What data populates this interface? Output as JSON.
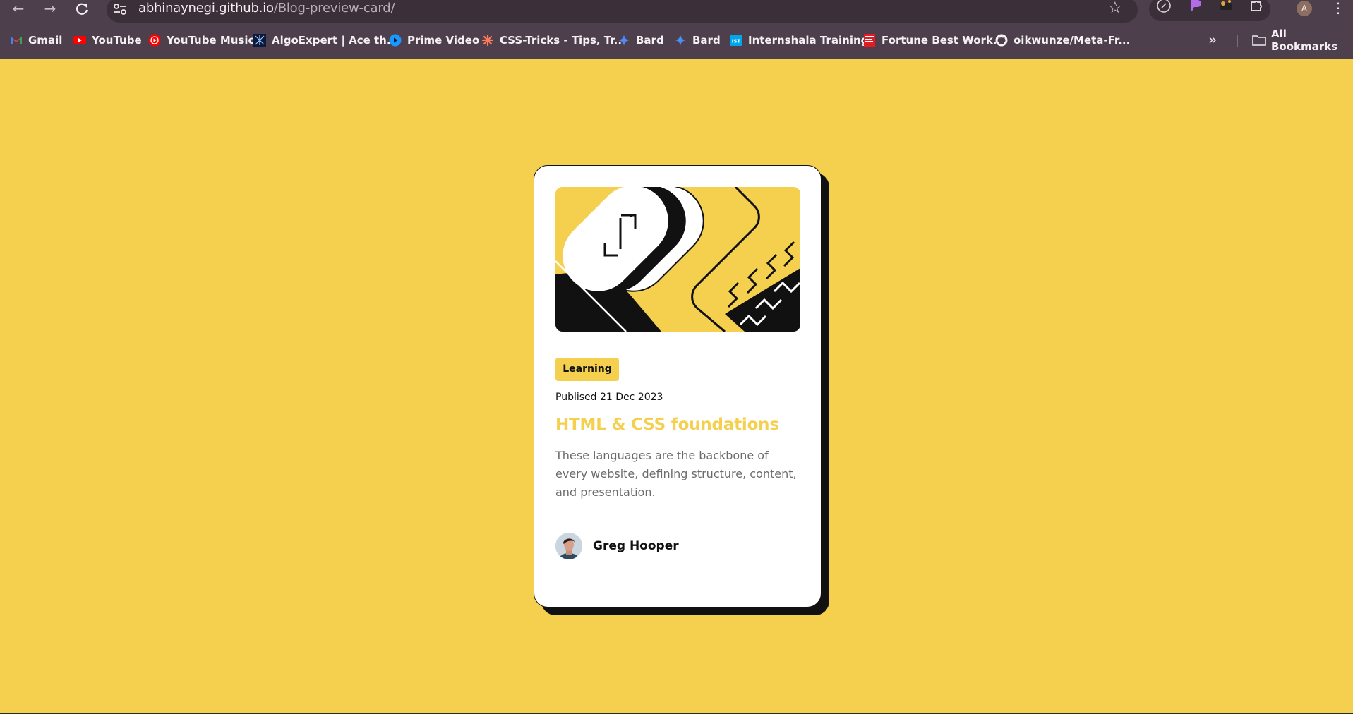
{
  "browser": {
    "url_host": "abhinaynegi.github.io",
    "url_path": "/Blog-preview-card/",
    "profile_initial": "A",
    "bookmarks": [
      {
        "label": "Gmail",
        "icon": "gmail-icon"
      },
      {
        "label": "YouTube",
        "icon": "youtube-icon"
      },
      {
        "label": "YouTube Music",
        "icon": "youtube-music-icon"
      },
      {
        "label": "AlgoExpert | Ace th...",
        "icon": "algoexpert-icon"
      },
      {
        "label": "Prime Video",
        "icon": "prime-video-icon"
      },
      {
        "label": "CSS-Tricks - Tips, Tr...",
        "icon": "css-tricks-icon"
      },
      {
        "label": "Bard",
        "icon": "bard-icon"
      },
      {
        "label": "Bard",
        "icon": "bard-icon"
      },
      {
        "label": "Internshala Trainings",
        "icon": "internshala-icon"
      },
      {
        "label": "Fortune Best Work...",
        "icon": "fortune-icon"
      },
      {
        "label": "oikwunze/Meta-Fr...",
        "icon": "github-icon"
      }
    ],
    "all_bookmarks_label": "All Bookmarks"
  },
  "card": {
    "tag": "Learning",
    "published": "Publised 21 Dec 2023",
    "title": "HTML & CSS foundations",
    "description": "These languages are the backbone of every website, defining structure, content, and presentation.",
    "author": "Greg Hooper"
  },
  "colors": {
    "background": "#f4d04e",
    "card": "#ffffff",
    "ink": "#111111",
    "chrome": "#4d3f4b"
  }
}
